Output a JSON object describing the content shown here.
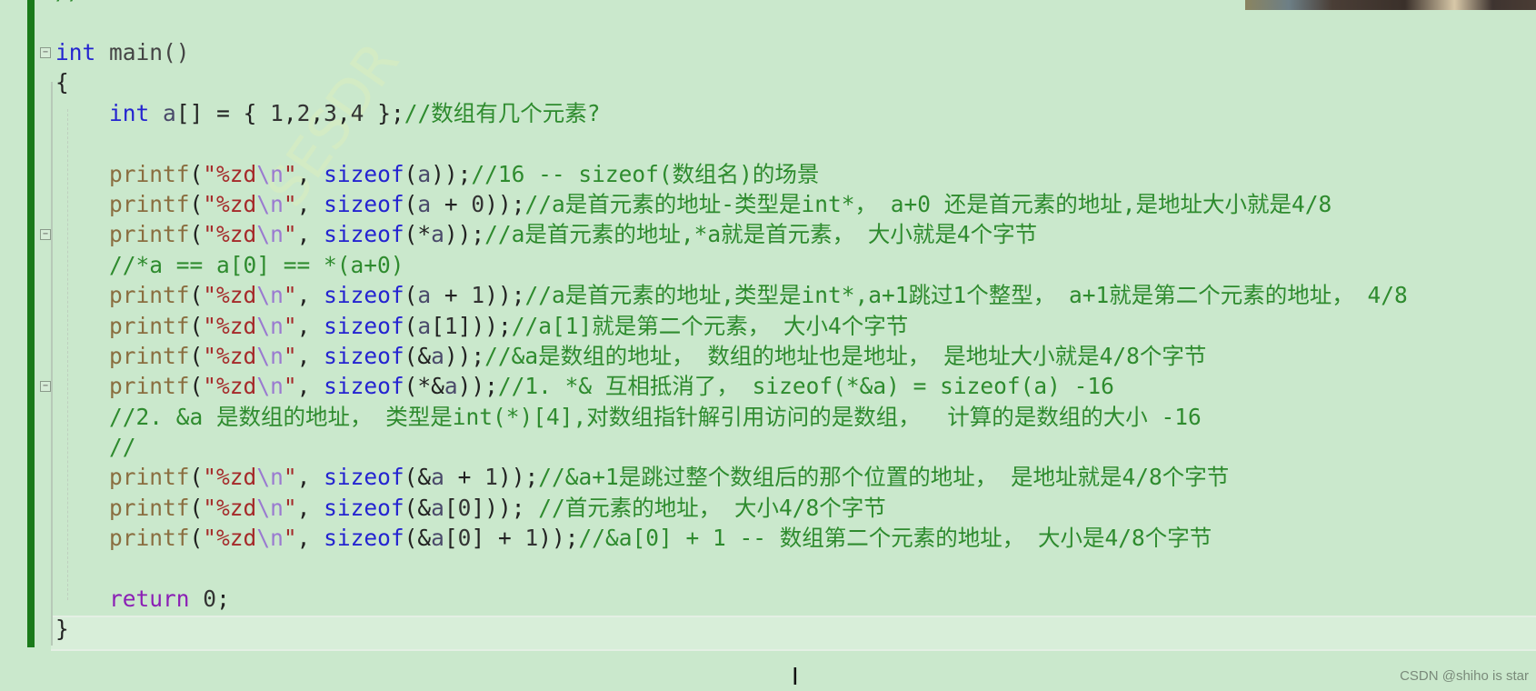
{
  "editor": {
    "first_line": [
      [
        "cm",
        "//"
      ]
    ],
    "lines": [
      {
        "fold": false,
        "tokens": []
      },
      {
        "fold": true,
        "tokens": [
          [
            "kw",
            "int"
          ],
          [
            "plain",
            " main()"
          ]
        ]
      },
      {
        "fold": false,
        "tokens": [
          [
            "p",
            "{"
          ]
        ]
      },
      {
        "fold": false,
        "tokens": [
          [
            "p",
            "    "
          ],
          [
            "kw",
            "int"
          ],
          [
            "p",
            " "
          ],
          [
            "id",
            "a"
          ],
          [
            "p",
            "[] = { "
          ],
          [
            "num",
            "1"
          ],
          [
            "p",
            ","
          ],
          [
            "num",
            "2"
          ],
          [
            "p",
            ","
          ],
          [
            "num",
            "3"
          ],
          [
            "p",
            ","
          ],
          [
            "num",
            "4"
          ],
          [
            "p",
            " };"
          ],
          [
            "cm",
            "//数组有几个元素?"
          ]
        ]
      },
      {
        "fold": false,
        "tokens": []
      },
      {
        "fold": false,
        "tokens": [
          [
            "p",
            "    "
          ],
          [
            "fn",
            "printf"
          ],
          [
            "p",
            "("
          ],
          [
            "str",
            "\"%zd"
          ],
          [
            "esc",
            "\\n"
          ],
          [
            "str",
            "\""
          ],
          [
            "p",
            ", "
          ],
          [
            "kw",
            "sizeof"
          ],
          [
            "p",
            "("
          ],
          [
            "id",
            "a"
          ],
          [
            "p",
            "));"
          ],
          [
            "cm",
            "//16 -- sizeof(数组名)的场景"
          ]
        ]
      },
      {
        "fold": false,
        "tokens": [
          [
            "p",
            "    "
          ],
          [
            "fn",
            "printf"
          ],
          [
            "p",
            "("
          ],
          [
            "str",
            "\"%zd"
          ],
          [
            "esc",
            "\\n"
          ],
          [
            "str",
            "\""
          ],
          [
            "p",
            ", "
          ],
          [
            "kw",
            "sizeof"
          ],
          [
            "p",
            "("
          ],
          [
            "id",
            "a"
          ],
          [
            "p",
            " + "
          ],
          [
            "num",
            "0"
          ],
          [
            "p",
            "));"
          ],
          [
            "cm",
            "//a是首元素的地址-类型是int*， a+0 还是首元素的地址,是地址大小就是4/8"
          ]
        ]
      },
      {
        "fold": true,
        "tokens": [
          [
            "p",
            "    "
          ],
          [
            "fn",
            "printf"
          ],
          [
            "p",
            "("
          ],
          [
            "str",
            "\"%zd"
          ],
          [
            "esc",
            "\\n"
          ],
          [
            "str",
            "\""
          ],
          [
            "p",
            ", "
          ],
          [
            "kw",
            "sizeof"
          ],
          [
            "p",
            "(*"
          ],
          [
            "id",
            "a"
          ],
          [
            "p",
            "));"
          ],
          [
            "cm",
            "//a是首元素的地址,*a就是首元素， 大小就是4个字节"
          ]
        ]
      },
      {
        "fold": false,
        "tokens": [
          [
            "p",
            "    "
          ],
          [
            "cm",
            "//*a == a[0] == *(a+0)"
          ]
        ]
      },
      {
        "fold": false,
        "tokens": [
          [
            "p",
            "    "
          ],
          [
            "fn",
            "printf"
          ],
          [
            "p",
            "("
          ],
          [
            "str",
            "\"%zd"
          ],
          [
            "esc",
            "\\n"
          ],
          [
            "str",
            "\""
          ],
          [
            "p",
            ", "
          ],
          [
            "kw",
            "sizeof"
          ],
          [
            "p",
            "("
          ],
          [
            "id",
            "a"
          ],
          [
            "p",
            " + "
          ],
          [
            "num",
            "1"
          ],
          [
            "p",
            "));"
          ],
          [
            "cm",
            "//a是首元素的地址,类型是int*,a+1跳过1个整型， a+1就是第二个元素的地址， 4/8"
          ]
        ]
      },
      {
        "fold": false,
        "tokens": [
          [
            "p",
            "    "
          ],
          [
            "fn",
            "printf"
          ],
          [
            "p",
            "("
          ],
          [
            "str",
            "\"%zd"
          ],
          [
            "esc",
            "\\n"
          ],
          [
            "str",
            "\""
          ],
          [
            "p",
            ", "
          ],
          [
            "kw",
            "sizeof"
          ],
          [
            "p",
            "("
          ],
          [
            "id",
            "a"
          ],
          [
            "p",
            "["
          ],
          [
            "num",
            "1"
          ],
          [
            "p",
            "]));"
          ],
          [
            "cm",
            "//a[1]就是第二个元素， 大小4个字节"
          ]
        ]
      },
      {
        "fold": false,
        "tokens": [
          [
            "p",
            "    "
          ],
          [
            "fn",
            "printf"
          ],
          [
            "p",
            "("
          ],
          [
            "str",
            "\"%zd"
          ],
          [
            "esc",
            "\\n"
          ],
          [
            "str",
            "\""
          ],
          [
            "p",
            ", "
          ],
          [
            "kw",
            "sizeof"
          ],
          [
            "p",
            "(&"
          ],
          [
            "id",
            "a"
          ],
          [
            "p",
            "));"
          ],
          [
            "cm",
            "//&a是数组的地址， 数组的地址也是地址， 是地址大小就是4/8个字节"
          ]
        ]
      },
      {
        "fold": true,
        "tokens": [
          [
            "p",
            "    "
          ],
          [
            "fn",
            "printf"
          ],
          [
            "p",
            "("
          ],
          [
            "str",
            "\"%zd"
          ],
          [
            "esc",
            "\\n"
          ],
          [
            "str",
            "\""
          ],
          [
            "p",
            ", "
          ],
          [
            "kw",
            "sizeof"
          ],
          [
            "p",
            "(*&"
          ],
          [
            "id",
            "a"
          ],
          [
            "p",
            "));"
          ],
          [
            "cm",
            "//1. *& 互相抵消了， sizeof(*&a) = sizeof(a) -16"
          ]
        ]
      },
      {
        "fold": false,
        "tokens": [
          [
            "p",
            "    "
          ],
          [
            "cm",
            "//2. &a 是数组的地址， 类型是int(*)[4],对数组指针解引用访问的是数组，  计算的是数组的大小 -16"
          ]
        ]
      },
      {
        "fold": false,
        "tokens": [
          [
            "p",
            "    "
          ],
          [
            "cm",
            "//"
          ]
        ]
      },
      {
        "fold": false,
        "tokens": [
          [
            "p",
            "    "
          ],
          [
            "fn",
            "printf"
          ],
          [
            "p",
            "("
          ],
          [
            "str",
            "\"%zd"
          ],
          [
            "esc",
            "\\n"
          ],
          [
            "str",
            "\""
          ],
          [
            "p",
            ", "
          ],
          [
            "kw",
            "sizeof"
          ],
          [
            "p",
            "(&"
          ],
          [
            "id",
            "a"
          ],
          [
            "p",
            " + "
          ],
          [
            "num",
            "1"
          ],
          [
            "p",
            "));"
          ],
          [
            "cm",
            "//&a+1是跳过整个数组后的那个位置的地址， 是地址就是4/8个字节"
          ]
        ]
      },
      {
        "fold": false,
        "tokens": [
          [
            "p",
            "    "
          ],
          [
            "fn",
            "printf"
          ],
          [
            "p",
            "("
          ],
          [
            "str",
            "\"%zd"
          ],
          [
            "esc",
            "\\n"
          ],
          [
            "str",
            "\""
          ],
          [
            "p",
            ", "
          ],
          [
            "kw",
            "sizeof"
          ],
          [
            "p",
            "(&"
          ],
          [
            "id",
            "a"
          ],
          [
            "p",
            "["
          ],
          [
            "num",
            "0"
          ],
          [
            "p",
            "])); "
          ],
          [
            "cm",
            "//首元素的地址， 大小4/8个字节"
          ]
        ]
      },
      {
        "fold": false,
        "tokens": [
          [
            "p",
            "    "
          ],
          [
            "fn",
            "printf"
          ],
          [
            "p",
            "("
          ],
          [
            "str",
            "\"%zd"
          ],
          [
            "esc",
            "\\n"
          ],
          [
            "str",
            "\""
          ],
          [
            "p",
            ", "
          ],
          [
            "kw",
            "sizeof"
          ],
          [
            "p",
            "(&"
          ],
          [
            "id",
            "a"
          ],
          [
            "p",
            "["
          ],
          [
            "num",
            "0"
          ],
          [
            "p",
            "] + "
          ],
          [
            "num",
            "1"
          ],
          [
            "p",
            "));"
          ],
          [
            "cm",
            "//&a[0] + 1 -- 数组第二个元素的地址， 大小是4/8个字节"
          ]
        ]
      },
      {
        "fold": false,
        "tokens": []
      },
      {
        "fold": false,
        "tokens": [
          [
            "p",
            "    "
          ],
          [
            "ret",
            "return"
          ],
          [
            "p",
            " "
          ],
          [
            "num",
            "0"
          ],
          [
            "p",
            ";"
          ]
        ]
      },
      {
        "fold": false,
        "tokens": [
          [
            "p",
            "}"
          ]
        ]
      }
    ],
    "colors": {
      "background": "#cae8cc",
      "change_bar": "#1a7a1a",
      "keyword": "#2424d0",
      "comment": "#2e8b2e",
      "string": "#a52a2a",
      "function": "#8a6e40",
      "return_keyword": "#8b1fb5"
    },
    "icons": {
      "fold": "collapse-box-icon",
      "cursor": "text-cursor-icon"
    }
  },
  "watermark": {
    "editor_faint": "SESDR",
    "csdn": "CSDN @shiho is star"
  }
}
